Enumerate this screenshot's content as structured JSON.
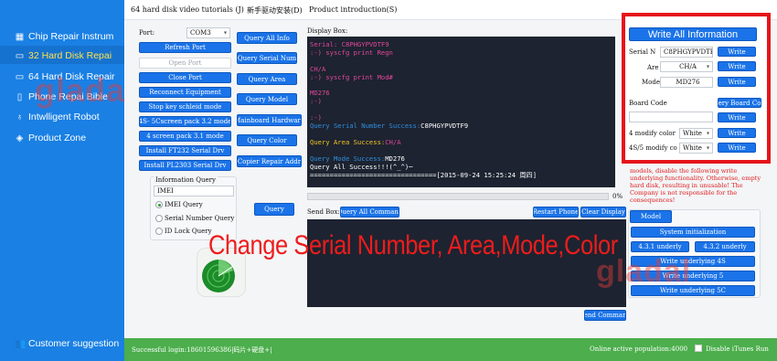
{
  "sidebar": {
    "items": [
      {
        "label": "Chip Repair Instrum",
        "icon": "grid-icon"
      },
      {
        "label": "32 Hard Disk Repai",
        "icon": "disk-icon"
      },
      {
        "label": "64 Hard Disk Repair",
        "icon": "disk-icon"
      },
      {
        "label": "Phone Repai Bible",
        "icon": "book-icon"
      },
      {
        "label": "Intwlligent Robot",
        "icon": "robot-icon"
      },
      {
        "label": "Product Zone",
        "icon": "cube-icon"
      }
    ],
    "customer": "Customer suggestion"
  },
  "menu": {
    "items": [
      "64 hard disk video tutorials (J)",
      "新手驱动安装(D)",
      "Product introduction(S)"
    ]
  },
  "left_panel": {
    "port_label": "Port:",
    "port_value": "COM3",
    "buttons": [
      "Refresh Port",
      "Open Port",
      "Close Port",
      "Reconnect Equipment",
      "Stop key schleid mode",
      "4S- 5Cscreen pack 3.2 mode",
      "4 screen pack 3.1 mode",
      "Install FT232 Serial Drv",
      "Install PL2303 Serial Drv"
    ],
    "info_query_title": "Information Query",
    "imei_value": "IMEI",
    "radios": [
      "IMEI Query",
      "Serial Number Query",
      "ID Lock Query"
    ],
    "query_btn": "Query"
  },
  "mid_buttons": [
    "Query All Info",
    "Query Serial Num",
    "Query Area",
    "Query Model",
    "Mainboard Hardware",
    "Query Color",
    "Copier Repair Addr"
  ],
  "display": {
    "label": "Display Box:",
    "lines": [
      {
        "text": "Serial: C8PHGYPVDTF9",
        "color": "#e0479a"
      },
      {
        "text": ":-) syscfg print Regn",
        "color": "#e0479a"
      },
      {
        "text": "",
        "color": "#e0479a"
      },
      {
        "text": "CH/A",
        "color": "#e0479a"
      },
      {
        "text": ":-) syscfg print Mod#",
        "color": "#e0479a"
      },
      {
        "text": "",
        "color": "#e0479a"
      },
      {
        "text": "MD276",
        "color": "#e0479a"
      },
      {
        "text": ":-)",
        "color": "#e0479a"
      },
      {
        "text": "",
        "color": "#e0479a"
      },
      {
        "text": ":-)",
        "color": "#e0479a"
      },
      {
        "text": "Query Serial Number Success:C8PHGYPVDTF9",
        "color": "#2f8fe0",
        "hl": "C8PHGYPVDTF9"
      },
      {
        "text": "",
        "color": "#fff"
      },
      {
        "text": "Query Area Success:CH/A",
        "color": "#f3c623",
        "hl": "CH/A"
      },
      {
        "text": "",
        "color": "#fff"
      },
      {
        "text": "Query Mode Success:MD276",
        "color": "#2f8fe0",
        "hl": "MD276"
      },
      {
        "text": "Query All Success!!!(^_^)─",
        "color": "#ffffff"
      },
      {
        "text": "================================[2015-09-24 15:25:24 周四]",
        "color": "#ffffff"
      }
    ]
  },
  "progress": {
    "value": 0,
    "text": "0%"
  },
  "send": {
    "label": "Send Box:",
    "query_all": "Query All Command",
    "restart": "Restart Phone",
    "clear": "Clear Display",
    "send_cmd": "Send Command"
  },
  "write_panel": {
    "title": "Write All Information",
    "rows": [
      {
        "label": "Serial N",
        "value": "C8PHGYPVDTF9",
        "btn": "Write"
      },
      {
        "label": "Are",
        "value": "CH/A",
        "btn": "Write",
        "dropdown": true
      },
      {
        "label": "Mode",
        "value": "MD276",
        "btn": "Write"
      }
    ],
    "board_label": "Board Code",
    "board_btn": "ery Board Co",
    "board_write": "Write",
    "color4_label": "4 modify color",
    "color4_value": "White",
    "color4_btn": "Write",
    "color45_label": "4S/5 modify co",
    "color45_value": "White",
    "color45_btn": "Write"
  },
  "warning": "models, disable the following write underlying functionality. Otherwise, empty hard disk, resulting in unusable! The Company is not responsible for the consequences!",
  "right_lower": {
    "model_btn": "Model",
    "buttons": [
      "System initialization",
      "4.3.1 underly",
      "4.3.2 underly",
      "Write underlying 4S",
      "Write underlying 5",
      "Write underlying 5C"
    ]
  },
  "overlay": {
    "banner": "Change Serial Number, Area,Mode,Color",
    "watermark1": "glada",
    "watermark2": "gladal"
  },
  "status": {
    "login": "Successful login:18601596386|码片+硬盘+|",
    "online": "Online active population:4000",
    "itunes": "Disable iTunes Run"
  }
}
